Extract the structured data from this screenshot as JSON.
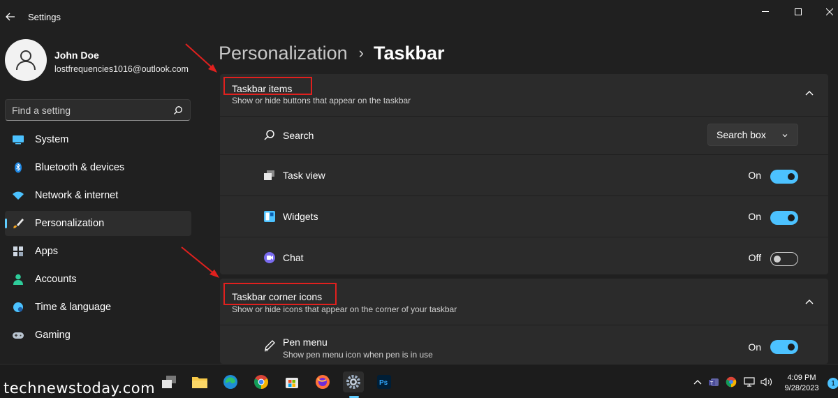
{
  "window": {
    "title": "Settings"
  },
  "profile": {
    "name": "John Doe",
    "email": "lostfrequencies1016@outlook.com"
  },
  "search": {
    "placeholder": "Find a setting"
  },
  "sidebar": {
    "items": [
      {
        "label": "System",
        "icon": "monitor-icon"
      },
      {
        "label": "Bluetooth & devices",
        "icon": "bluetooth-icon"
      },
      {
        "label": "Network & internet",
        "icon": "wifi-icon"
      },
      {
        "label": "Personalization",
        "icon": "brush-icon",
        "active": true
      },
      {
        "label": "Apps",
        "icon": "apps-icon"
      },
      {
        "label": "Accounts",
        "icon": "person-icon"
      },
      {
        "label": "Time & language",
        "icon": "globe-icon"
      },
      {
        "label": "Gaming",
        "icon": "gamepad-icon"
      }
    ]
  },
  "breadcrumb": {
    "parent": "Personalization",
    "separator": "›",
    "current": "Taskbar"
  },
  "taskbar_items": {
    "title": "Taskbar items",
    "subtitle": "Show or hide buttons that appear on the taskbar",
    "rows": {
      "search": {
        "label": "Search",
        "value": "Search box"
      },
      "task_view": {
        "label": "Task view",
        "state": "On"
      },
      "widgets": {
        "label": "Widgets",
        "state": "On"
      },
      "chat": {
        "label": "Chat",
        "state": "Off"
      }
    }
  },
  "corner_icons": {
    "title": "Taskbar corner icons",
    "subtitle": "Show or hide icons that appear on the corner of your taskbar",
    "rows": {
      "pen_menu": {
        "label": "Pen menu",
        "desc": "Show pen menu icon when pen is in use",
        "state": "On"
      }
    }
  },
  "taskbar": {
    "watermark": "technewstoday.com",
    "time": "4:09 PM",
    "date": "9/28/2023",
    "notifications": "1"
  },
  "colors": {
    "accent": "#4cc2ff",
    "highlight": "#e0201e",
    "background": "#202020",
    "card": "#2b2b2b"
  }
}
